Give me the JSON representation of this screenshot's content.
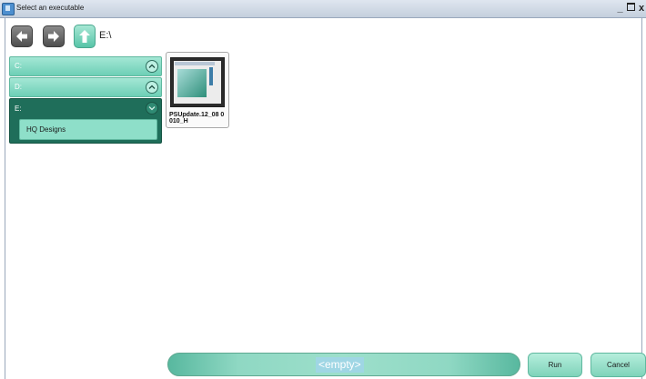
{
  "window": {
    "title": "Select an executable",
    "controls": {
      "minimize": "_",
      "close": "x"
    }
  },
  "nav": {
    "back_icon": "arrow-left-icon",
    "forward_icon": "arrow-right-icon",
    "up_icon": "arrow-up-icon",
    "current_path": "E:\\"
  },
  "drives": [
    {
      "label": "C:",
      "expanded": false
    },
    {
      "label": "D:",
      "expanded": false
    },
    {
      "label": "E:",
      "expanded": true,
      "folders": [
        "HQ Designs"
      ]
    }
  ],
  "files": [
    {
      "name": "PSUpdate.12_08 0010_H",
      "icon": "app-thumbnail-icon"
    }
  ],
  "footer": {
    "selection_value": "<empty>",
    "run_label": "Run",
    "cancel_label": "Cancel"
  },
  "colors": {
    "accent": "#7fd3ba",
    "dark_accent": "#1f6e5a",
    "titlebar": "#c4cfdd"
  }
}
